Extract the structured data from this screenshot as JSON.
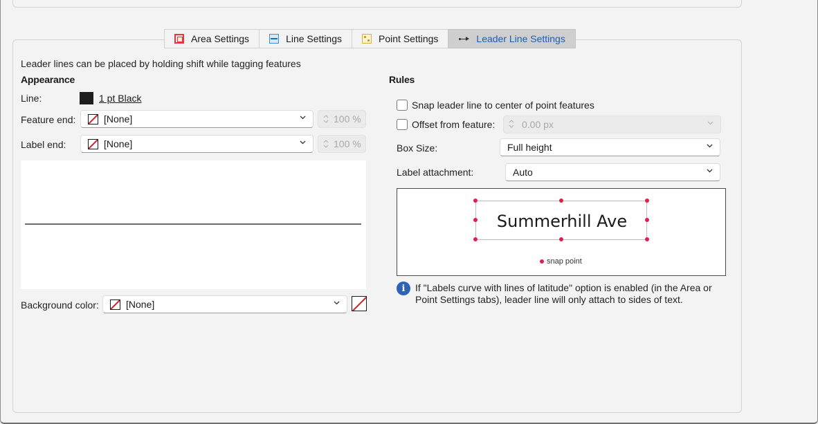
{
  "tabs": [
    {
      "label": "Area Settings",
      "icon": "area-settings-icon"
    },
    {
      "label": "Line Settings",
      "icon": "line-settings-icon"
    },
    {
      "label": "Point Settings",
      "icon": "point-settings-icon"
    },
    {
      "label": "Leader Line Settings",
      "icon": "leader-line-icon",
      "active": true
    }
  ],
  "description": "Leader lines can be placed by holding shift while tagging features",
  "appearance": {
    "heading": "Appearance",
    "line_label": "Line:",
    "line_value": "1 pt Black",
    "line_color": "#1e1e1e",
    "feature_end_label": "Feature end:",
    "feature_end_value": "[None]",
    "feature_end_percent": "100 %",
    "label_end_label": "Label end:",
    "label_end_value": "[None]",
    "label_end_percent": "100 %",
    "background_label": "Background color:",
    "background_value": "[None]"
  },
  "rules": {
    "heading": "Rules",
    "snap_label": "Snap leader line to center of point features",
    "snap_checked": false,
    "offset_label": "Offset from feature:",
    "offset_checked": false,
    "offset_value": "0.00 px",
    "box_size_label": "Box Size:",
    "box_size_value": "Full height",
    "attachment_label": "Label attachment:",
    "attachment_value": "Auto",
    "preview_text": "Summerhill Ave",
    "snap_legend": "snap point",
    "snap_color": "#e01f4f",
    "info_text": "If \"Labels curve with lines of latitude\" option is enabled (in the Area or Point Settings tabs), leader line will only attach to sides of text.",
    "info_icon": "info-icon"
  },
  "colors": {
    "active_tab_text": "#1a5fb4",
    "none_slash": "#d4202a"
  }
}
